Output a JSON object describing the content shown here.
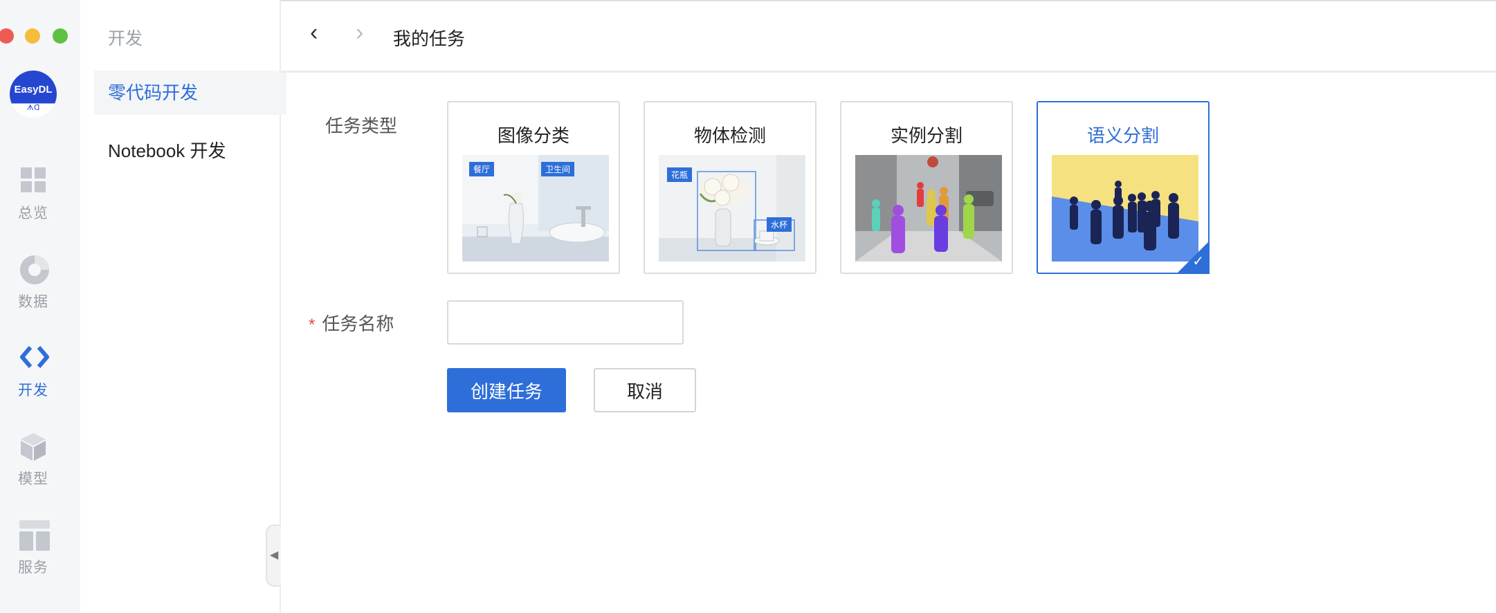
{
  "window": {
    "controls": [
      "close",
      "minimize",
      "maximize"
    ]
  },
  "brand": {
    "logo_text": "EasyDL",
    "logo_subtext": "ᗑᗡ"
  },
  "rail": {
    "items": [
      {
        "label": "总览",
        "icon": "grid-icon"
      },
      {
        "label": "数据",
        "icon": "donut-chart-icon"
      },
      {
        "label": "开发",
        "icon": "code-icon",
        "active": true
      },
      {
        "label": "模型",
        "icon": "cube-icon"
      },
      {
        "label": "服务",
        "icon": "layout-icon"
      }
    ]
  },
  "subnav": {
    "title": "开发",
    "items": [
      {
        "label": "零代码开发",
        "active": true
      },
      {
        "label": "Notebook 开发"
      }
    ]
  },
  "header": {
    "breadcrumb": "我的任务"
  },
  "form": {
    "task_type_label": "任务类型",
    "task_types": [
      {
        "label": "图像分类",
        "tags": [
          "餐厅",
          "卫生间"
        ]
      },
      {
        "label": "物体检测",
        "tags": [
          "花瓶",
          "水杯"
        ]
      },
      {
        "label": "实例分割",
        "tags": []
      },
      {
        "label": "语义分割",
        "tags": [],
        "selected": true
      }
    ],
    "task_name_label": "任务名称",
    "task_name_value": "",
    "task_name_placeholder": "",
    "create_button": "创建任务",
    "cancel_button": "取消"
  },
  "colors": {
    "accent": "#2e6ed8",
    "required": "#e04a3b",
    "rail_bg": "#f5f6f8",
    "close": "#ee5b52",
    "minimize": "#f5bd3a",
    "maximize": "#5fc143"
  }
}
